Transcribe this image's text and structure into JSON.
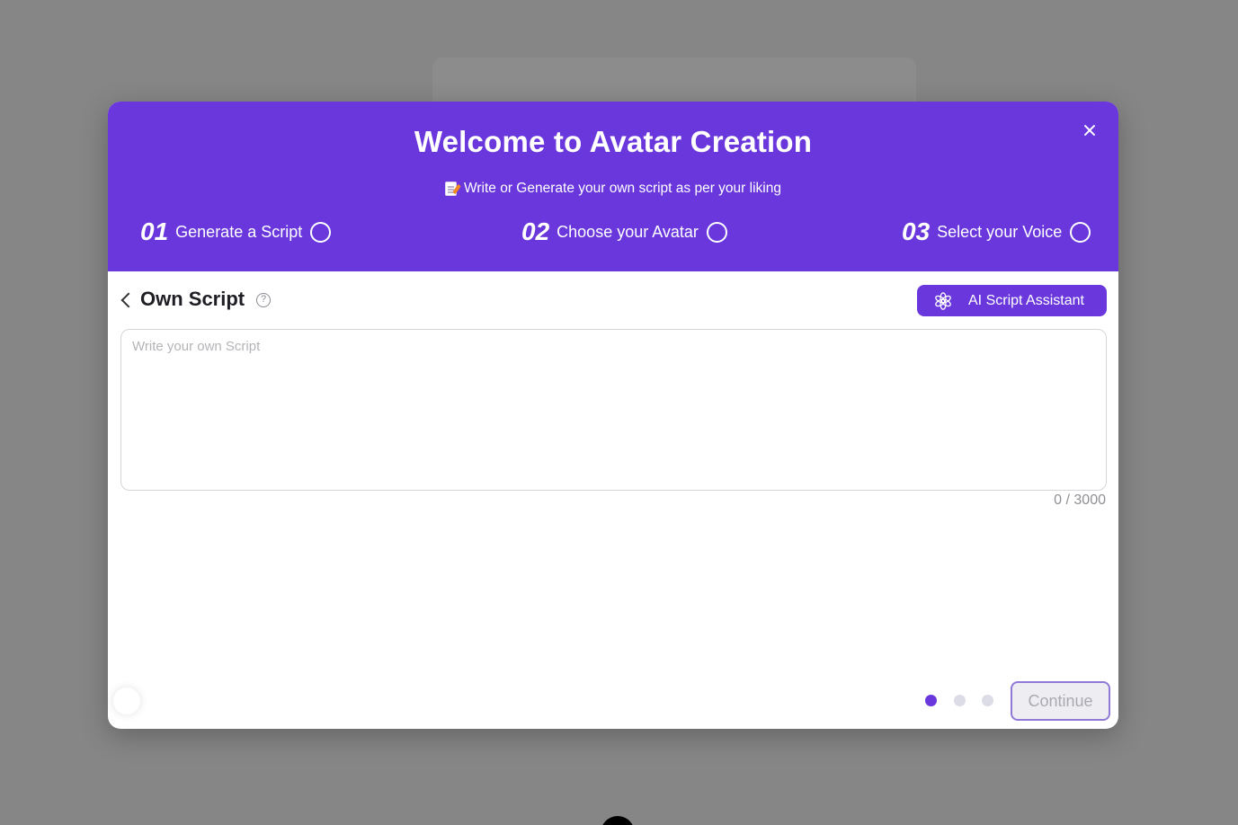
{
  "modal": {
    "title": "Welcome to Avatar Creation",
    "subtitle": "Write or Generate your own script as per your liking",
    "subtitle_icon": "memo-icon",
    "close_icon": "close-icon",
    "steps": [
      {
        "number": "01",
        "label": "Generate a Script"
      },
      {
        "number": "02",
        "label": "Choose your Avatar"
      },
      {
        "number": "03",
        "label": "Select your Voice"
      }
    ]
  },
  "script_section": {
    "title": "Own Script",
    "help_glyph": "?",
    "ai_button_label": "AI Script Assistant",
    "ai_button_icon": "openai-icon",
    "textarea_placeholder": "Write your own Script",
    "textarea_value": "",
    "char_count": "0 / 3000"
  },
  "footer": {
    "pagination": {
      "total": 3,
      "active": 1
    },
    "continue_label": "Continue"
  },
  "colors": {
    "accent": "#6937dc",
    "overlay": "rgba(0,0,0,0.45)"
  }
}
